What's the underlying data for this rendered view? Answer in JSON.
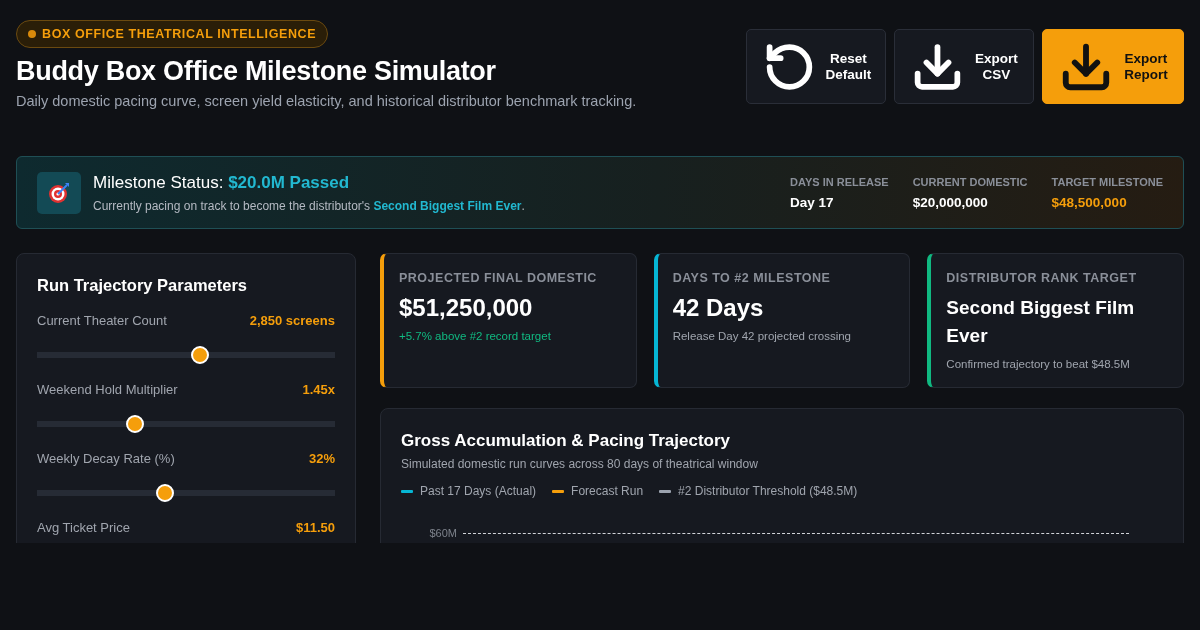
{
  "header": {
    "badge": "BOX OFFICE THEATRICAL INTELLIGENCE",
    "title": "Buddy Box Office Milestone Simulator",
    "subtitle": "Daily domestic pacing curve, screen yield elasticity, and historical distributor benchmark tracking."
  },
  "actions": [
    {
      "kind": "reset",
      "label": "Reset Default",
      "primary": false
    },
    {
      "kind": "download",
      "label": "Export CSV",
      "primary": false
    },
    {
      "kind": "download",
      "label": "Export Report",
      "primary": true
    }
  ],
  "status": {
    "title": "Milestone Status: **$20.0M Passed**",
    "text": "Currently pacing on track to become the distributor's **Second Biggest Film Ever**.",
    "stats": [
      {
        "label": "DAYS IN RELEASE",
        "value": "Day 17",
        "highlight": false
      },
      {
        "label": "CURRENT DOMESTIC",
        "value": "$20,000,000",
        "highlight": false
      },
      {
        "label": "TARGET MILESTONE",
        "value": "$48,500,000",
        "highlight": true
      }
    ]
  },
  "parameters": {
    "title": "Run Trajectory Parameters",
    "sliders": [
      {
        "label": "Current Theater Count",
        "reading": "2,850 screens",
        "level": 0.547
      },
      {
        "label": "Weekend Hold Multiplier",
        "reading": "1.45x",
        "level": 0.33
      },
      {
        "label": "Weekly Decay Rate (%)",
        "reading": "32%",
        "level": 0.43
      },
      {
        "label": "Avg Ticket Price",
        "reading": "$11.50"
      }
    ]
  },
  "cards": [
    {
      "label": "PROJECTED FINAL DOMESTIC",
      "value": "$51,250,000",
      "note": "+5.7% above #2 record target",
      "color": "#f59e0b",
      "positive": true
    },
    {
      "label": "DAYS TO #2 MILESTONE",
      "value": "42 Days",
      "note": "Release Day 42 projected crossing",
      "color": "#06b6d4",
      "positive": false
    },
    {
      "label": "DISTRIBUTOR RANK TARGET",
      "value": "Second Biggest Film Ever",
      "note": "Confirmed trajectory to beat $48.5M",
      "color": "#10b981",
      "positive": false
    }
  ],
  "chart": {
    "title": "Gross Accumulation & Pacing Trajectory",
    "subtitle": "Simulated domestic run curves across 80 days of theatrical window",
    "legend": [
      {
        "label": "Past 17 Days (Actual)",
        "color": "#06b6d4"
      },
      {
        "label": "Forecast Run",
        "color": "#f59e0b"
      },
      {
        "label": "#2 Distributor Threshold ($48.5M)",
        "color": "#9ca3af"
      }
    ],
    "y_tick_labels": [
      "$60M"
    ]
  }
}
